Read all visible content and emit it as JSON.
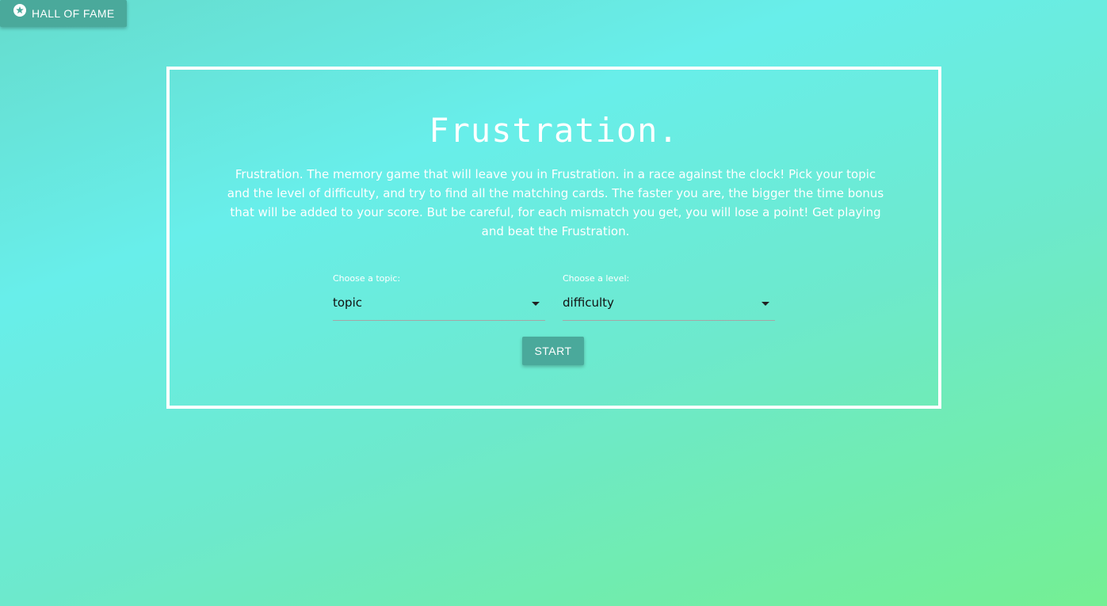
{
  "hall_of_fame": {
    "label": "HALL OF FAME",
    "icon": "star-circle-icon"
  },
  "main": {
    "title": "Frustration.",
    "description": "Frustration. The memory game that will leave you in Frustration. in a race against the clock! Pick your topic and the level of difficulty, and try to find all the matching cards. The faster you are, the bigger the time bonus that will be added to your score. But be careful, for each mismatch you get, you will lose a point! Get playing and beat the Frustration.",
    "topic_select": {
      "label": "Choose a topic:",
      "value": "topic"
    },
    "level_select": {
      "label": "Choose a level:",
      "value": "difficulty"
    },
    "start_label": "START"
  },
  "colors": {
    "button": "#4aa99b",
    "background_start": "#66dccd",
    "background_mid": "#68eeea",
    "background_end": "#74ef93",
    "border": "#ffffff"
  }
}
